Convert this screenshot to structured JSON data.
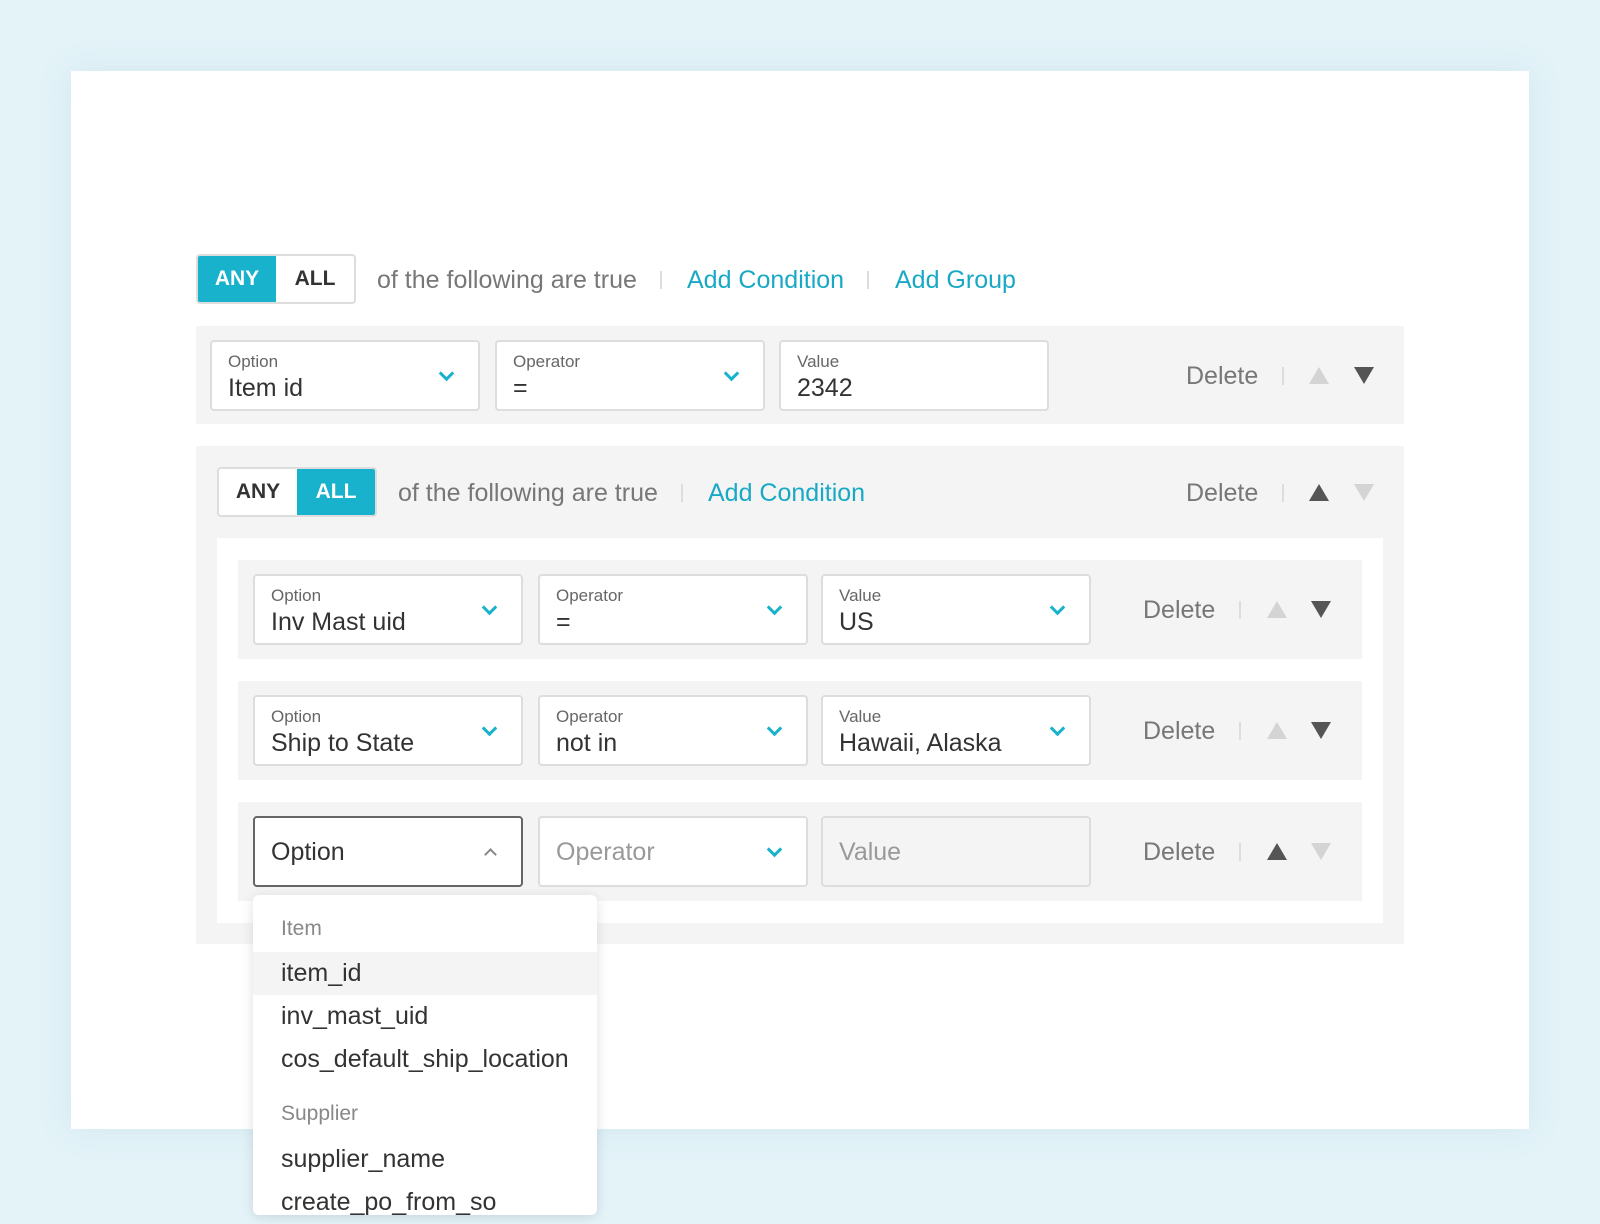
{
  "top": {
    "any": "ANY",
    "all": "ALL",
    "selected": "ANY",
    "text": "of the following are true",
    "add_condition": "Add Condition",
    "add_group": "Add Group"
  },
  "row1": {
    "option_label": "Option",
    "option": "Item id",
    "operator_label": "Operator",
    "operator": "=",
    "value_label": "Value",
    "value": "2342",
    "delete": "Delete"
  },
  "group": {
    "any": "ANY",
    "all": "ALL",
    "selected": "ALL",
    "text": "of the following are true",
    "add_condition": "Add Condition",
    "delete": "Delete",
    "rows": [
      {
        "option_label": "Option",
        "option": "Inv Mast uid",
        "operator_label": "Operator",
        "operator": "=",
        "value_label": "Value",
        "value": "US",
        "delete": "Delete"
      },
      {
        "option_label": "Option",
        "option": "Ship to State",
        "operator_label": "Operator",
        "operator": "not in",
        "value_label": "Value",
        "value": "Hawaii, Alaska",
        "delete": "Delete"
      },
      {
        "option_placeholder": "Option",
        "operator_placeholder": "Operator",
        "value_placeholder": "Value",
        "delete": "Delete"
      }
    ]
  },
  "dropdown": {
    "groups": [
      {
        "label": "Item",
        "items": [
          "item_id",
          "inv_mast_uid",
          "cos_default_ship_location"
        ]
      },
      {
        "label": "Supplier",
        "items": [
          "supplier_name",
          "create_po_from_so"
        ]
      }
    ],
    "highlighted": "item_id"
  },
  "colors": {
    "accent": "#19b2cc",
    "background": "#e3f3f8"
  }
}
